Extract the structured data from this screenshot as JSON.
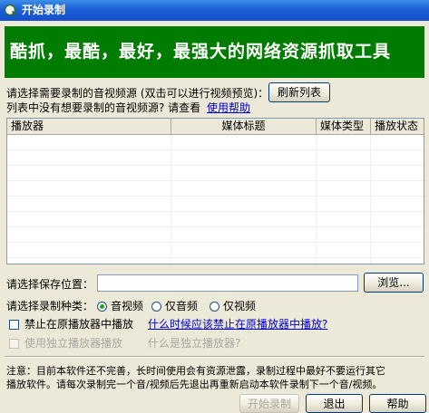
{
  "window": {
    "title": "开始录制"
  },
  "banner": {
    "text": "酷抓，最酷，最好，最强大的网络资源抓取工具"
  },
  "source": {
    "prompt": "请选择需要录制的音视频源 (双击可以进行视频预览)：",
    "refresh_label": "刷新列表",
    "missing_prompt": "列表中没有想要录制的音视频源? 请查看",
    "help_link": "使用帮助"
  },
  "table": {
    "columns": [
      "播放器",
      "媒体标题",
      "媒体类型",
      "播放状态"
    ]
  },
  "save": {
    "label": "请选择保存位置：",
    "path_value": "",
    "browse_label": "浏览..."
  },
  "record_type": {
    "label": "请选择录制种类：",
    "options": [
      "音视频",
      "仅音频",
      "仅视频"
    ],
    "selected": "音视频"
  },
  "options": {
    "no_play_label": "禁止在原播放器中播放",
    "no_play_link": "什么时候应该禁止在原播放器中播放?",
    "standalone_label": "使用独立播放器播放",
    "standalone_link": "什么是独立播放器?"
  },
  "notice": {
    "line1": "注意：目前本软件还不完善，长时间使用会有资源泄露，录制过程中最好不要运行其它",
    "line2": "播放软件。请每次录制完一个音/视频后先退出再重新启动本软件录制下一个音/视频。"
  },
  "footer": {
    "start_label": "开始录制",
    "exit_label": "退出",
    "help_label": "帮助"
  },
  "colors": {
    "banner_bg": "#007c00",
    "title_bar": "#1a5fd6",
    "link": "#0000cc"
  }
}
